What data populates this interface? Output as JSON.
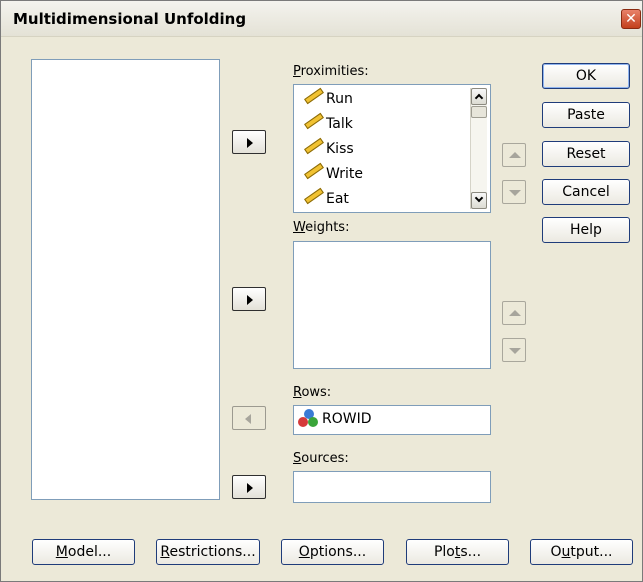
{
  "window": {
    "title": "Multidimensional Unfolding",
    "close_glyph": "✕"
  },
  "proximities": {
    "label": "Proximities:",
    "mnemonic": "P",
    "label_rest": "roximities:",
    "items": [
      "Run",
      "Talk",
      "Kiss",
      "Write",
      "Eat"
    ]
  },
  "weights": {
    "label": "Weights:",
    "mnemonic": "W",
    "label_rest": "eights:"
  },
  "rows": {
    "label": "Rows:",
    "mnemonic": "R",
    "label_rest": "ows:",
    "value": "ROWID"
  },
  "sources": {
    "label": "Sources:",
    "mnemonic": "S",
    "label_rest": "ources:"
  },
  "side_buttons": {
    "ok": "OK",
    "paste": "Paste",
    "reset": "Reset",
    "cancel": "Cancel",
    "help": "Help"
  },
  "bottom_buttons": {
    "model": {
      "m": "M",
      "rest": "odel..."
    },
    "restrictions": {
      "m": "R",
      "rest": "estrictions..."
    },
    "options": {
      "m": "O",
      "rest": "ptions..."
    },
    "plots": {
      "pre": "Plo",
      "m": "t",
      "rest": "s..."
    },
    "output": {
      "pre": "O",
      "m": "u",
      "rest": "tput..."
    }
  },
  "colors": {
    "accent_border": "#7f9db9",
    "dialog_bg": "#ece9d8"
  }
}
